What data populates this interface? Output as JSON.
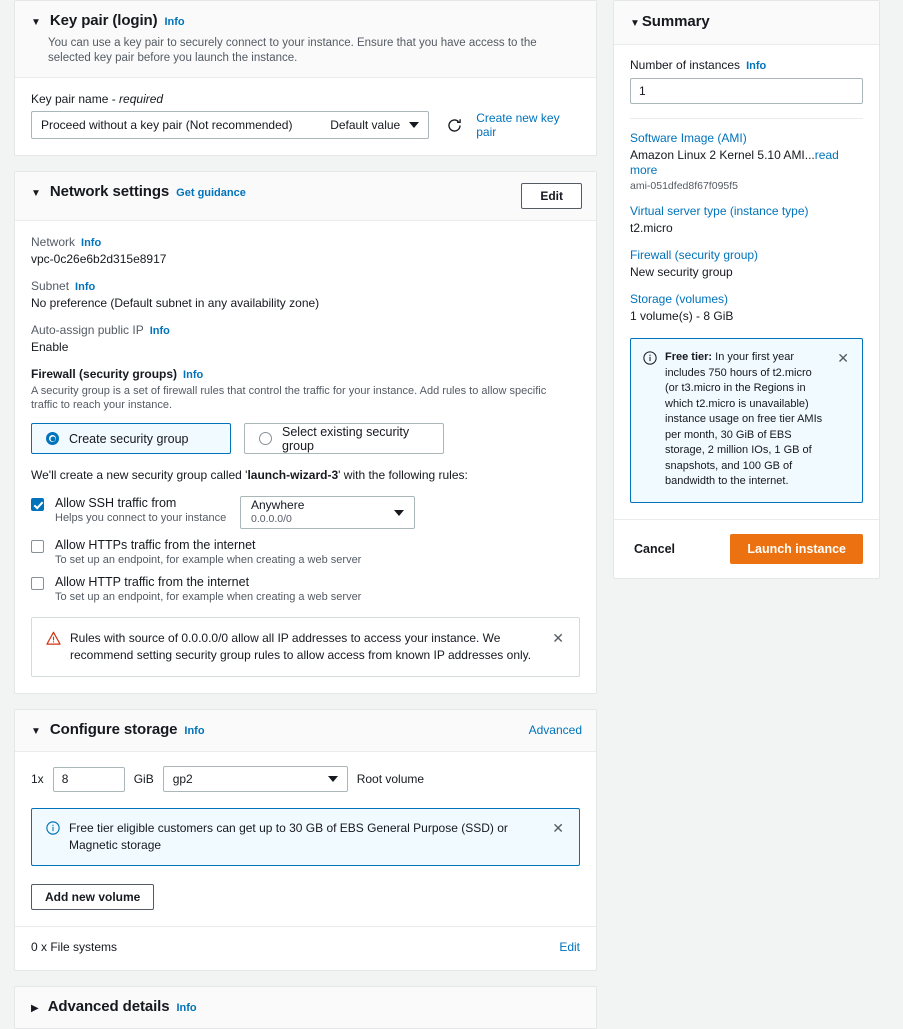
{
  "key_pair": {
    "title": "Key pair (login)",
    "info_label": "Info",
    "description": "You can use a key pair to securely connect to your instance. Ensure that you have access to the selected key pair before you launch the instance.",
    "field_label": "Key pair name -",
    "field_label_required": "required",
    "selected_value": "Proceed without a key pair (Not recommended)",
    "selected_secondary": "Default value",
    "create_link": "Create new key pair"
  },
  "network": {
    "title": "Network settings",
    "guidance_label": "Get guidance",
    "edit_label": "Edit",
    "network_label": "Network",
    "network_info": "Info",
    "network_value": "vpc-0c26e6b2d315e8917",
    "subnet_label": "Subnet",
    "subnet_info": "Info",
    "subnet_value": "No preference (Default subnet in any availability zone)",
    "autoip_label": "Auto-assign public IP",
    "autoip_info": "Info",
    "autoip_value": "Enable",
    "firewall_label": "Firewall (security groups)",
    "firewall_info": "Info",
    "firewall_desc": "A security group is a set of firewall rules that control the traffic for your instance. Add rules to allow specific traffic to reach your instance.",
    "option_create": "Create security group",
    "option_select": "Select existing security group",
    "sg_note_prefix": "We'll create a new security group called '",
    "sg_name": "launch-wizard-3",
    "sg_note_suffix": "' with the following rules:",
    "rules": [
      {
        "label": "Allow SSH traffic from",
        "sub": "Helps you connect to your instance",
        "checked": true,
        "source_main": "Anywhere",
        "source_sub": "0.0.0.0/0"
      },
      {
        "label": "Allow HTTPs traffic from the internet",
        "sub": "To set up an endpoint, for example when creating a web server",
        "checked": false
      },
      {
        "label": "Allow HTTP traffic from the internet",
        "sub": "To set up an endpoint, for example when creating a web server",
        "checked": false
      }
    ],
    "warning_text": "Rules with source of 0.0.0.0/0 allow all IP addresses to access your instance. We recommend setting security group rules to allow access from known IP addresses only."
  },
  "storage": {
    "title": "Configure storage",
    "info_label": "Info",
    "advanced_label": "Advanced",
    "multiplier": "1x",
    "size_value": "8",
    "unit": "GiB",
    "volume_type": "gp2",
    "root_label": "Root volume",
    "info_text": "Free tier eligible customers can get up to 30 GB of EBS General Purpose (SSD) or Magnetic storage",
    "add_volume_label": "Add new volume",
    "file_systems_label": "0 x File systems",
    "edit_label": "Edit"
  },
  "advanced": {
    "title": "Advanced details",
    "info_label": "Info"
  },
  "summary": {
    "title": "Summary",
    "instances_label": "Number of instances",
    "instances_info": "Info",
    "instances_value": "1",
    "ami_link": "Software Image (AMI)",
    "ami_value": "Amazon Linux 2 Kernel 5.10 AMI...",
    "ami_read_more": "read more",
    "ami_id": "ami-051dfed8f67f095f5",
    "instance_type_link": "Virtual server type (instance type)",
    "instance_type_value": "t2.micro",
    "firewall_link": "Firewall (security group)",
    "firewall_value": "New security group",
    "storage_link": "Storage (volumes)",
    "storage_value": "1 volume(s) - 8 GiB",
    "free_tier_title": "Free tier:",
    "free_tier_text": " In your first year includes 750 hours of t2.micro (or t3.micro in the Regions in which t2.micro is unavailable) instance usage on free tier AMIs per month, 30 GiB of EBS storage, 2 million IOs, 1 GB of snapshots, and 100 GB of bandwidth to the internet.",
    "cancel_label": "Cancel",
    "launch_label": "Launch instance"
  },
  "colors": {
    "accent_blue": "#0073bb",
    "launch_orange": "#ec7211",
    "warning_red": "#d13212",
    "page_bg": "#f2f3f3"
  },
  "icons": {
    "caret_down": "▼",
    "caret_right": "▶",
    "close": "✕"
  }
}
